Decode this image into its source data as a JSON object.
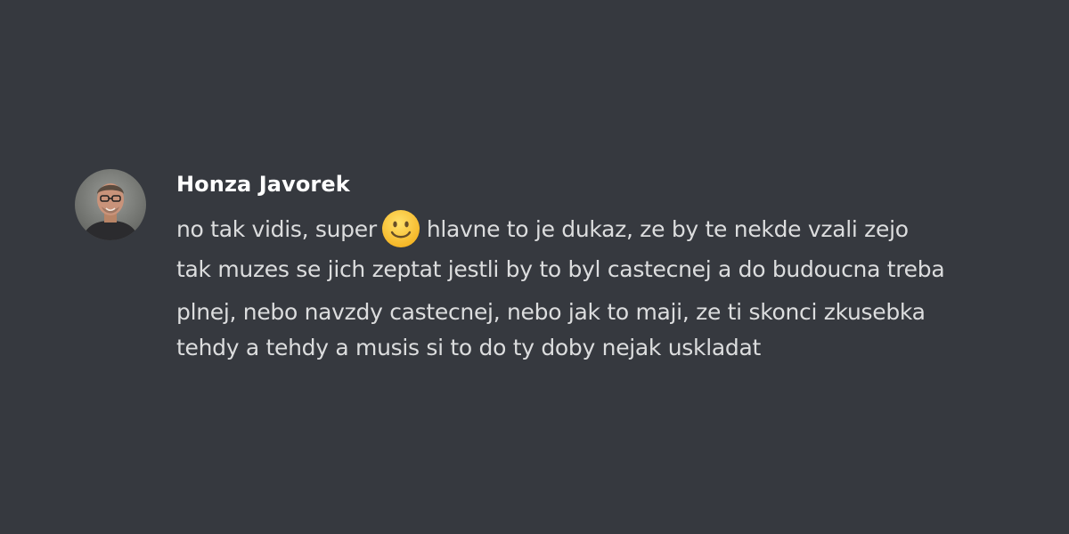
{
  "message": {
    "author": "Honza Javorek",
    "avatar_icon": "user-avatar",
    "line1_before_emoji": "no tak vidis, super",
    "emoji": "slightly-smiling-face-icon",
    "line1_after_emoji": "hlavne to je dukaz, ze by te nekde vzali zejo",
    "line2": "tak muzes se jich zeptat jestli by to byl castecnej a do budoucna treba",
    "line3": "plnej, nebo navzdy castecnej, nebo jak to maji, ze ti skonci zkusebka",
    "line4": "tehdy a tehdy a musis si to do ty doby nejak uskladat"
  },
  "colors": {
    "background": "#36393f",
    "username": "#ffffff",
    "text": "#dcddde"
  }
}
